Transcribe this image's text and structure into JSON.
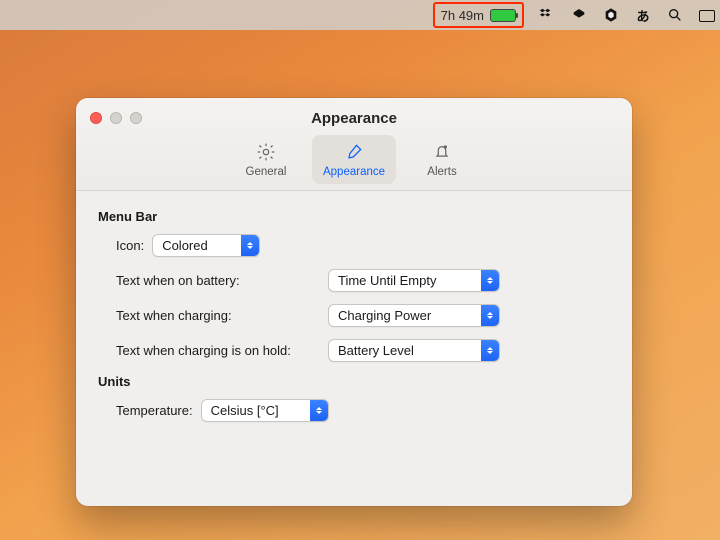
{
  "menubar": {
    "battery_text": "7h 49m"
  },
  "window": {
    "title": "Appearance",
    "tabs": {
      "general": "General",
      "appearance": "Appearance",
      "alerts": "Alerts"
    },
    "sections": {
      "menubar": {
        "heading": "Menu Bar",
        "icon_label": "Icon:",
        "icon_value": "Colored",
        "twob_label": "Text when on battery:",
        "twob_value": "Time Until Empty",
        "twc_label": "Text when charging:",
        "twc_value": "Charging Power",
        "twch_label": "Text when charging is on hold:",
        "twch_value": "Battery Level"
      },
      "units": {
        "heading": "Units",
        "temp_label": "Temperature:",
        "temp_value": "Celsius [°C]"
      }
    }
  }
}
